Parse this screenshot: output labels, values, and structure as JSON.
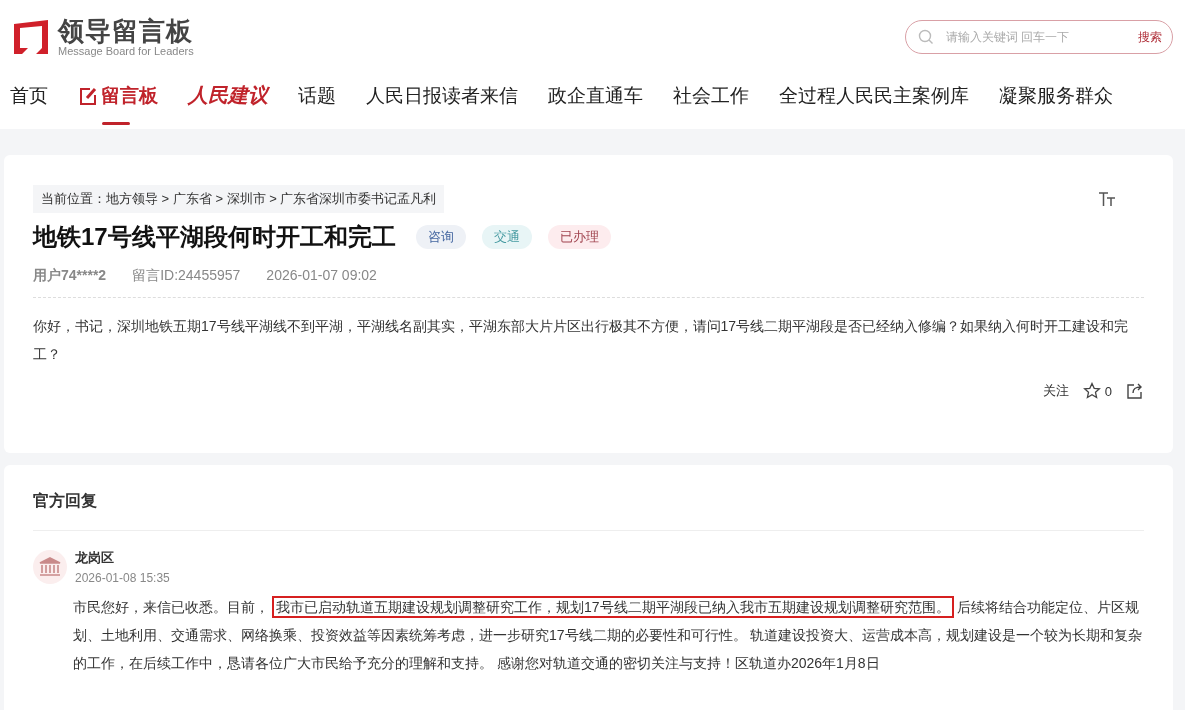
{
  "header": {
    "logo": {
      "title": "领导留言板",
      "subtitle": "Message Board for Leaders"
    },
    "search": {
      "placeholder": "请输入关键词 回车一下",
      "button": "搜索"
    }
  },
  "nav": [
    {
      "label": "首页",
      "kind": "text",
      "selected": false
    },
    {
      "label": "留言板",
      "kind": "board",
      "selected": true
    },
    {
      "label": "人民建议",
      "kind": "script",
      "selected": false
    },
    {
      "label": "话题",
      "kind": "text",
      "selected": false
    },
    {
      "label": "人民日报读者来信",
      "kind": "text",
      "selected": false
    },
    {
      "label": "政企直通车",
      "kind": "text",
      "selected": false
    },
    {
      "label": "社会工作",
      "kind": "text",
      "selected": false
    },
    {
      "label": "全过程人民民主案例库",
      "kind": "text",
      "selected": false
    },
    {
      "label": "凝聚服务群众",
      "kind": "text",
      "selected": false
    }
  ],
  "message": {
    "breadcrumb": "当前位置：地方领导 > 广东省 > 深圳市 > 广东省深圳市委书记孟凡利",
    "title": "地铁17号线平湖段何时开工和完工",
    "tags": [
      {
        "label": "咨询",
        "color": "#eef1f6"
      },
      {
        "label": "交通",
        "color": "#e8f5f6"
      },
      {
        "label": "已办理",
        "color": "#fdecee"
      }
    ],
    "user": "用户74****2",
    "id": "留言ID:24455957",
    "time": "2026-01-07 09:02",
    "body": "你好，书记，深圳地铁五期17号线平湖线不到平湖，平湖线名副其实，平湖东部大片片区出行极其不方便，请问17号线二期平湖段是否已经纳入修编？如果纳入何时开工建设和完工？",
    "follow": "关注",
    "likes": "0"
  },
  "reply": {
    "heading": "官方回复",
    "department": "龙岗区",
    "time": "2026-01-08 15:35",
    "body": [
      {
        "text": "市民您好，来信已收悉。目前，",
        "highlighted": false
      },
      {
        "text": "我市已启动轨道五期建设规划调整研究工作，规划17号线二期平湖段已纳入我市五期建设规划调整研究范围。",
        "highlighted": true
      },
      {
        "text": "后续将结合功能定位、片区规划、土地利用、交通需求、网络换乘、投资效益等因素统筹考虑，进一步研究17号线二期的必要性和可行性。 轨道建设投资大、运营成本高，规划建设是一个较为长期和复杂的工作，在后续工作中，恳请各位广大市民给予充分的理解和支持。 感谢您对轨道交通的密切关注与支持！区轨道办2026年1月8日",
        "highlighted": false
      }
    ]
  }
}
